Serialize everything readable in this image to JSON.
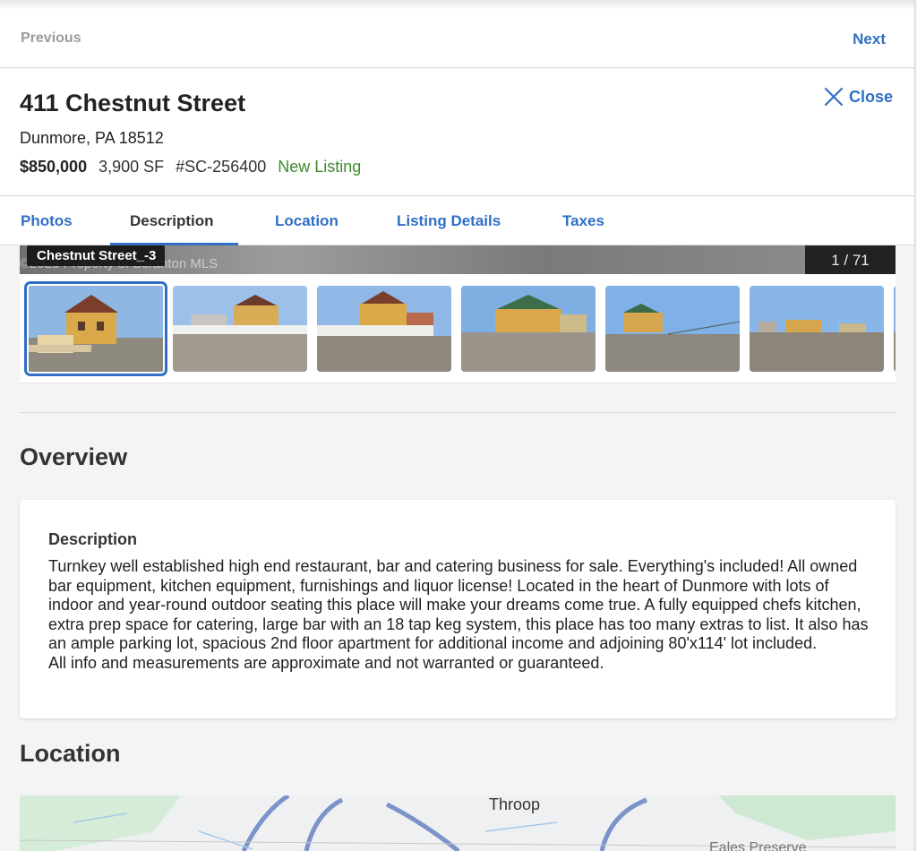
{
  "nav": {
    "previous": "Previous",
    "next": "Next"
  },
  "listing": {
    "address": "411 Chestnut Street",
    "city_line": "Dunmore, PA 18512",
    "price": "$850,000",
    "size": "3,900 SF",
    "mls_id": "#SC-256400",
    "status": "New Listing",
    "close_label": "Close"
  },
  "tabs": [
    {
      "label": "Photos",
      "active": false
    },
    {
      "label": "Description",
      "active": true
    },
    {
      "label": "Location",
      "active": false
    },
    {
      "label": "Listing Details",
      "active": false
    },
    {
      "label": "Taxes",
      "active": false
    }
  ],
  "gallery": {
    "caption": "Chestnut Street_-3",
    "watermark": "©2023 Property of Scranton MLS",
    "counter": "1 / 71"
  },
  "overview": {
    "heading": "Overview",
    "desc_label": "Description",
    "desc_lines": [
      "Turnkey well established high end restaurant, bar and catering business for sale. Everything's included! All owned bar equipment, kitchen equipment, furnishings and liquor license! Located in the heart of Dunmore with lots of indoor and year-round outdoor seating this place will make your dreams come true. A fully equipped chefs kitchen, extra prep space for catering, large bar with an 18 tap keg system, this place has too many extras to list. It also has an ample parking lot, spacious 2nd floor apartment for additional income and adjoining 80'x114' lot included.",
      "All info and measurements are approximate and not warranted or guaranteed."
    ]
  },
  "location": {
    "heading": "Location",
    "map_label": "Throop",
    "map_label_2": "Eales Preserve"
  },
  "colors": {
    "accent": "#2f6fc4",
    "status_green": "#3c8a2e"
  },
  "icons": {
    "close": "close-icon"
  }
}
